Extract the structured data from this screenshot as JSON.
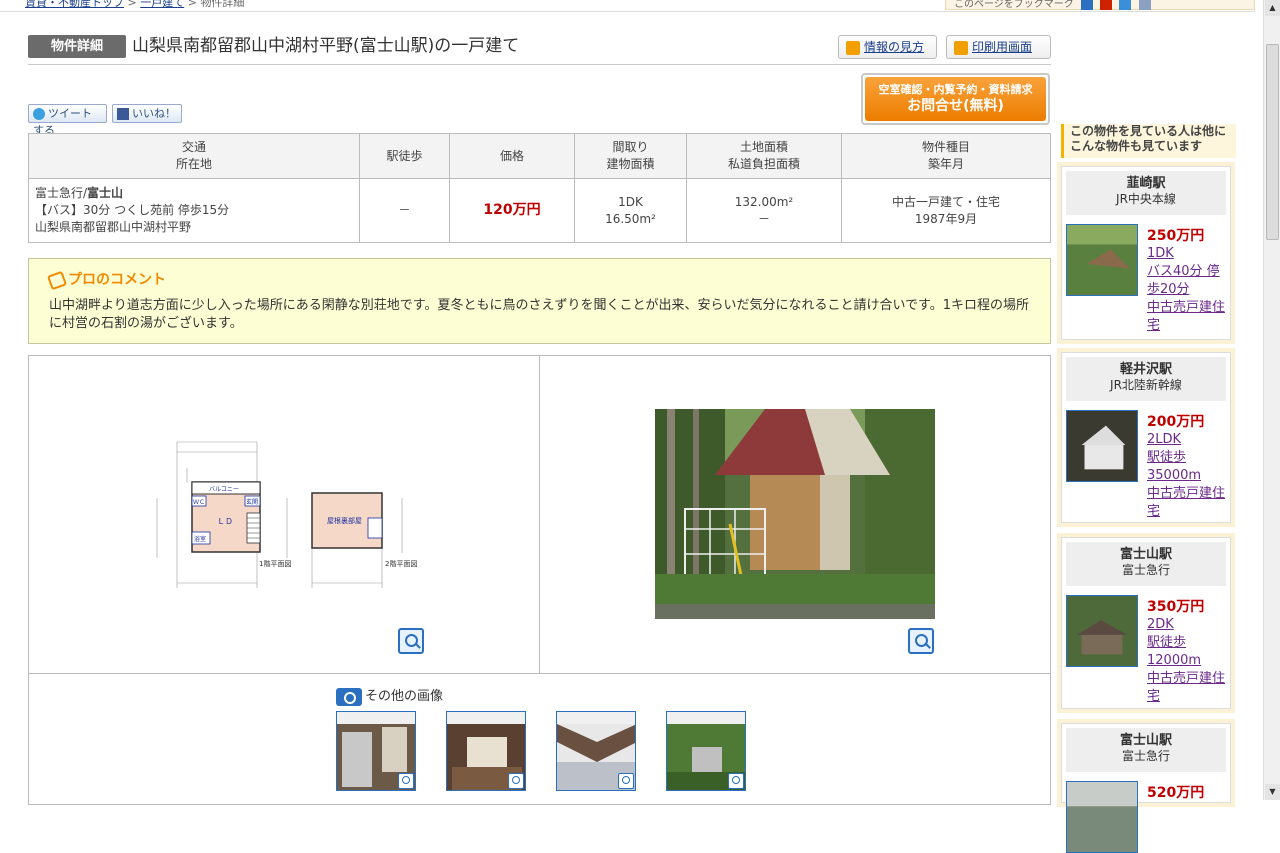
{
  "topbar": {
    "breadcrumb_1": "賃貸・不動産トップ",
    "breadcrumb_sep": ">",
    "breadcrumb_2": "一戸建て",
    "breadcrumb_3": "物件詳細",
    "share_text": "このページをブックマーク"
  },
  "header": {
    "badge": "物件詳細",
    "title": "山梨県南都留郡山中湖村平野(富士山駅)の一戸建て",
    "guide_label": "情報の見方",
    "print_label": "印刷用画面"
  },
  "social": {
    "tweet": "ツイートする",
    "like": "いいね！"
  },
  "cta": {
    "line1": "空室確認・内覧予約・資料請求",
    "line2": "お問合せ(無料)"
  },
  "table": {
    "headers": [
      [
        "交通",
        "所在地"
      ],
      [
        "駅徒歩"
      ],
      [
        "価格"
      ],
      [
        "間取り",
        "建物面積"
      ],
      [
        "土地面積",
        "私道負担面積"
      ],
      [
        "物件種目",
        "築年月"
      ]
    ],
    "row": {
      "line_route": "富士急行/",
      "line_station": "富士山",
      "bus": "【バス】30分 つくし苑前 停歩15分",
      "address": "山梨県南都留郡山中湖村平野",
      "walk": "－",
      "price": "120万円",
      "layout": "1DK",
      "building_area": "16.50m²",
      "land_area": "132.00m²",
      "private_road": "－",
      "type": "中古一戸建て・住宅",
      "built": "1987年9月"
    }
  },
  "pro_comment": {
    "title": "プロのコメント",
    "text": "山中湖畔より道志方面に少し入った場所にある閑静な別荘地です。夏冬ともに鳥のさえずりを聞くことが出来、安らいだ気分になれること請け合いです。1キロ程の場所に村営の石割の湯がございます。"
  },
  "floorplan": {
    "label_1f": "1階平面図",
    "label_2f": "2階平面図",
    "ldk": "ＬＤ",
    "balcony": "バルコニー",
    "attic": "屋根裏部屋",
    "bath": "浴室",
    "wc": "ＷＣ",
    "entrance": "玄関"
  },
  "other_images": {
    "label": "その他の画像"
  },
  "sidebar": {
    "header": "この物件を見ている人は他にこんな物件も見ています",
    "cards": [
      {
        "station": "韮崎駅",
        "line": "JR中央本線",
        "price": "250万円",
        "layout": "1DK",
        "access": "バス40分 停歩20分",
        "type": "中古売戸建住宅"
      },
      {
        "station": "軽井沢駅",
        "line": "JR北陸新幹線",
        "price": "200万円",
        "layout": "2LDK",
        "access": "駅徒歩35000m",
        "type": "中古売戸建住宅"
      },
      {
        "station": "富士山駅",
        "line": "富士急行",
        "price": "350万円",
        "layout": "2DK",
        "access": "駅徒歩12000m",
        "type": "中古売戸建住宅"
      },
      {
        "station": "富士山駅",
        "line": "富士急行",
        "price": "520万円",
        "layout": "",
        "access": "",
        "type": ""
      }
    ]
  },
  "colors": {
    "price": "#c00000",
    "accent": "#f08a00",
    "link": "#1a3f8c",
    "visited": "#6a2a8a"
  }
}
